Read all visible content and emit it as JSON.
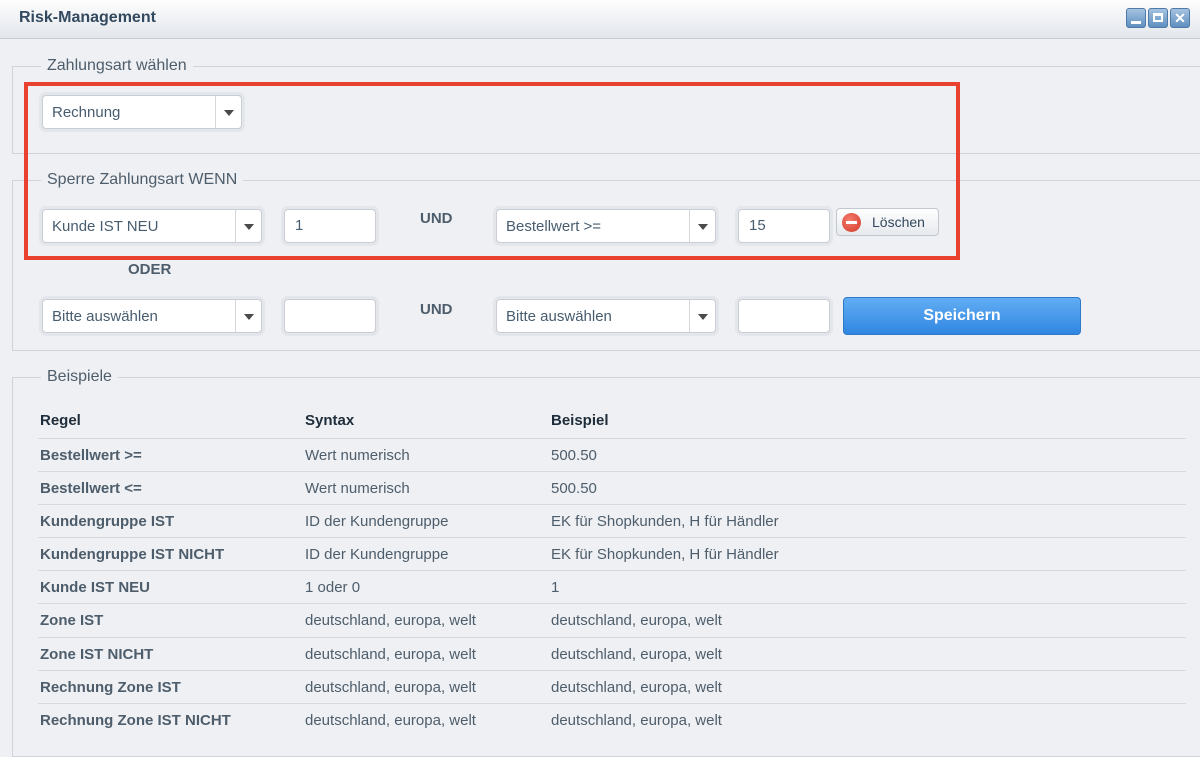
{
  "window": {
    "title": "Risk-Management"
  },
  "payment": {
    "legend": "Zahlungsart wählen",
    "selected": "Rechnung"
  },
  "rules": {
    "legend": "Sperre Zahlungsart WENN",
    "row1": {
      "condition1": "Kunde IST NEU",
      "value1": "1",
      "connector": "UND",
      "condition2": "Bestellwert >=",
      "value2": "15",
      "delete_label": "Löschen"
    },
    "or_label": "ODER",
    "row2": {
      "condition1": "Bitte auswählen",
      "value1": "",
      "connector": "UND",
      "condition2": "Bitte auswählen",
      "value2": "",
      "save_label": "Speichern"
    }
  },
  "examples": {
    "legend": "Beispiele",
    "headers": [
      "Regel",
      "Syntax",
      "Beispiel"
    ],
    "rows": [
      [
        "Bestellwert >=",
        "Wert numerisch",
        "500.50"
      ],
      [
        "Bestellwert <=",
        "Wert numerisch",
        "500.50"
      ],
      [
        "Kundengruppe IST",
        "ID der Kundengruppe",
        "EK für Shopkunden, H für Händler"
      ],
      [
        "Kundengruppe IST NICHT",
        "ID der Kundengruppe",
        "EK für Shopkunden, H für Händler"
      ],
      [
        "Kunde IST NEU",
        "1 oder 0",
        "1"
      ],
      [
        "Zone IST",
        "deutschland, europa, welt",
        "deutschland, europa, welt"
      ],
      [
        "Zone IST NICHT",
        "deutschland, europa, welt",
        "deutschland, europa, welt"
      ],
      [
        "Rechnung Zone IST",
        "deutschland, europa, welt",
        "deutschland, europa, welt"
      ],
      [
        "Rechnung Zone IST NICHT",
        "deutschland, europa, welt",
        "deutschland, europa, welt"
      ]
    ]
  },
  "colors": {
    "highlight": "#e8412f",
    "save_button": "#2f86e0",
    "delete_icon": "#d23a2a"
  }
}
